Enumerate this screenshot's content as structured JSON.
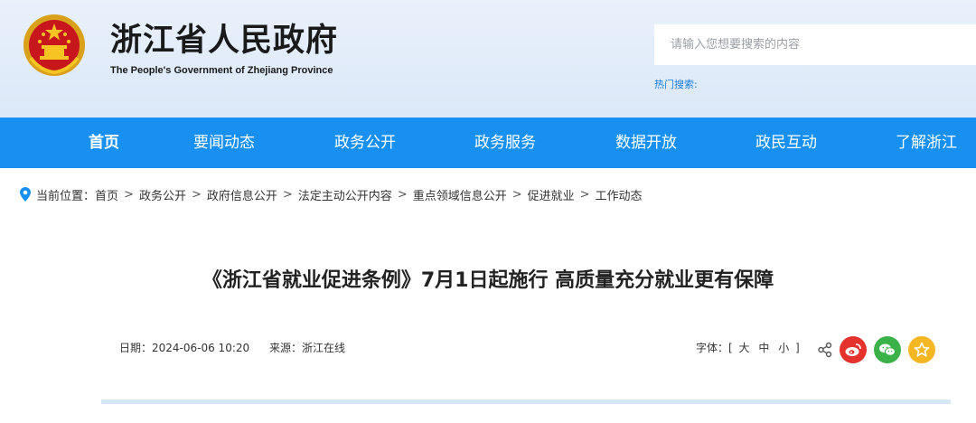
{
  "header": {
    "title": "浙江省人民政府",
    "subtitle": "The People's Government of Zhejiang Province",
    "search_placeholder": "请输入您想要搜索的内容",
    "hot_search_label": "热门搜索:"
  },
  "nav": {
    "items": [
      {
        "label": "首页",
        "active": true
      },
      {
        "label": "要闻动态"
      },
      {
        "label": "政务公开"
      },
      {
        "label": "政务服务"
      },
      {
        "label": "数据开放"
      },
      {
        "label": "政民互动"
      },
      {
        "label": "了解浙江"
      }
    ]
  },
  "breadcrumb": {
    "prefix": "当前位置：",
    "items": [
      "首页",
      "政务公开",
      "政府信息公开",
      "法定主动公开内容",
      "重点领域信息公开",
      "促进就业",
      "工作动态"
    ],
    "separator": ">"
  },
  "article": {
    "title": "《浙江省就业促进条例》7月1日起施行 高质量充分就业更有保障",
    "date": "日期：2024-06-06 10:20",
    "source": "来源：浙江在线"
  },
  "font_size": {
    "label": "字体：[",
    "options": [
      "大",
      "中",
      "小"
    ],
    "close": "]"
  },
  "colors": {
    "nav_bg": "#1890f2",
    "header_bg": "#e3eefa",
    "link_blue": "#1a7ee0",
    "weibo": "#e6322d",
    "wechat": "#3bb14a",
    "favorite": "#f5b623"
  },
  "icons": [
    "national-emblem",
    "location-pin-icon",
    "share-icon",
    "weibo-icon",
    "wechat-icon",
    "favorite-star-icon"
  ]
}
